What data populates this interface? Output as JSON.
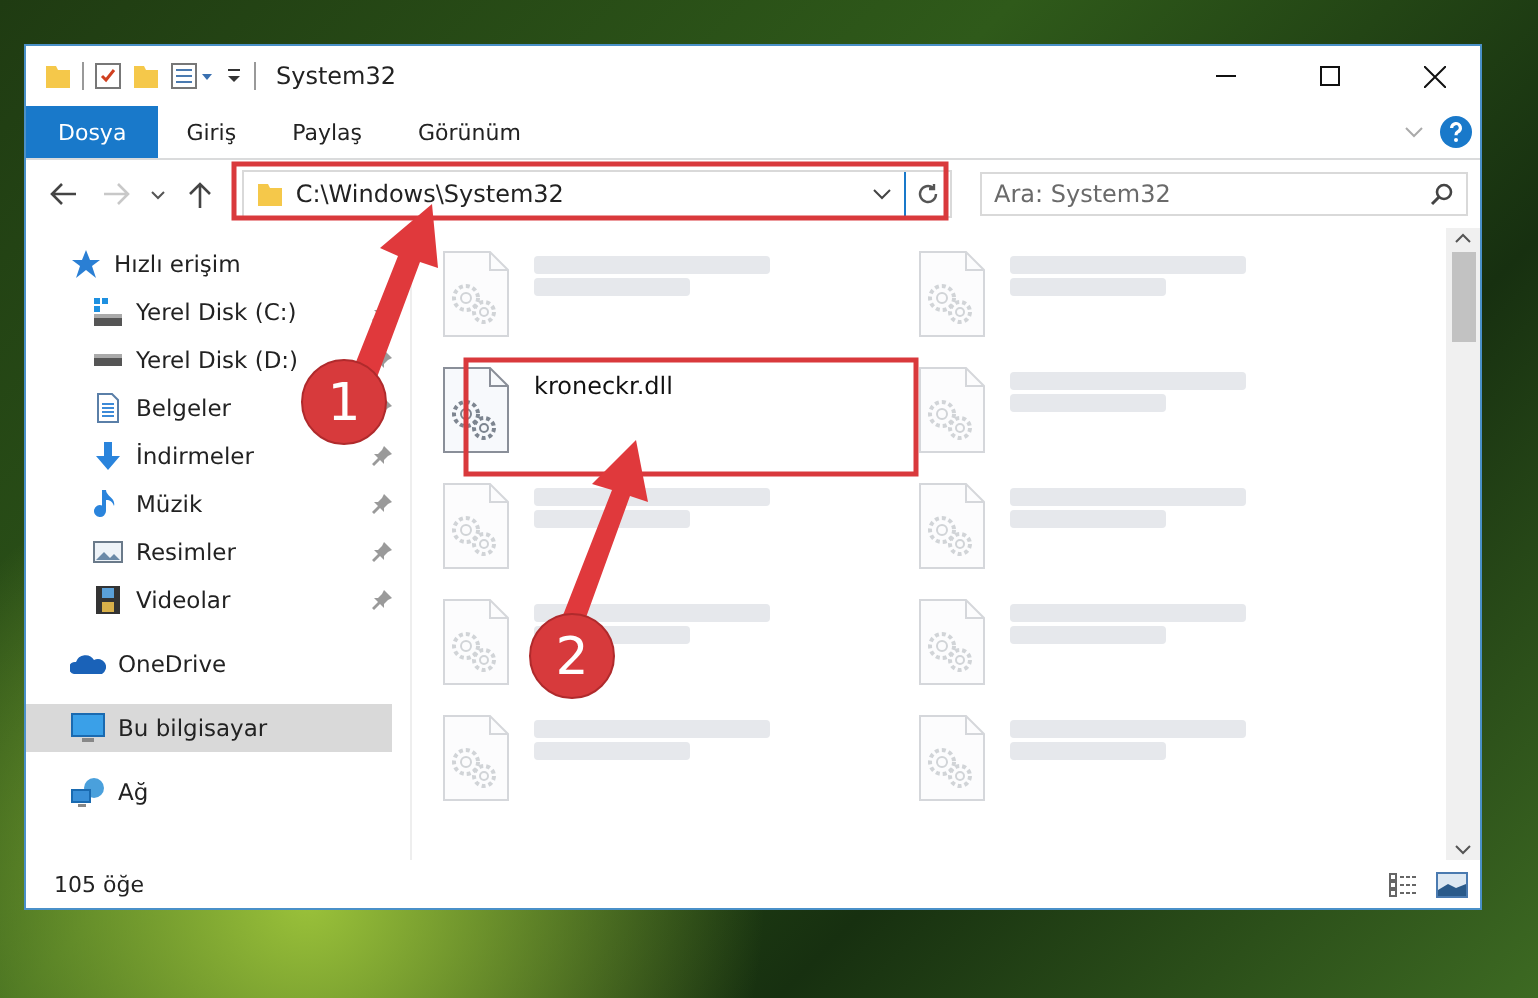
{
  "window": {
    "title": "System32"
  },
  "ribbon_tabs": [
    {
      "label": "Dosya",
      "selected": true
    },
    {
      "label": "Giriş",
      "selected": false
    },
    {
      "label": "Paylaş",
      "selected": false
    },
    {
      "label": "Görünüm",
      "selected": false
    }
  ],
  "address_bar": {
    "path": "C:\\Windows\\System32"
  },
  "search": {
    "placeholder": "Ara: System32"
  },
  "sidebar": [
    {
      "label": "Hızlı erişim",
      "kind": "star",
      "selected": false,
      "children": [
        {
          "label": "Yerel Disk (C:)",
          "kind": "system-drive",
          "pinned": true,
          "selected": false
        },
        {
          "label": "Yerel Disk (D:)",
          "kind": "drive",
          "pinned": true,
          "selected": false
        },
        {
          "label": "Belgeler",
          "kind": "documents",
          "pinned": true,
          "selected": false
        },
        {
          "label": "İndirmeler",
          "kind": "downloads",
          "pinned": true,
          "selected": false
        },
        {
          "label": "Müzik",
          "kind": "music",
          "pinned": true,
          "selected": false
        },
        {
          "label": "Resimler",
          "kind": "pictures",
          "pinned": true,
          "selected": false
        },
        {
          "label": "Videolar",
          "kind": "videos",
          "pinned": true,
          "selected": false
        }
      ]
    },
    {
      "label": "OneDrive",
      "kind": "cloud",
      "selected": false
    },
    {
      "label": "Bu bilgisayar",
      "kind": "computer",
      "selected": true
    },
    {
      "label": "Ağ",
      "kind": "network",
      "selected": false
    }
  ],
  "files": [
    {
      "dimmed": true
    },
    {
      "dimmed": true
    },
    {
      "name": "kroneckr.dll",
      "dimmed": false
    },
    {
      "dimmed": true
    },
    {
      "dimmed": true
    },
    {
      "dimmed": true
    },
    {
      "dimmed": true
    },
    {
      "dimmed": true
    },
    {
      "dimmed": true
    },
    {
      "dimmed": true
    }
  ],
  "status_bar": {
    "item_count": "105 öğe"
  },
  "annotations": [
    {
      "number": "1"
    },
    {
      "number": "2"
    }
  ]
}
